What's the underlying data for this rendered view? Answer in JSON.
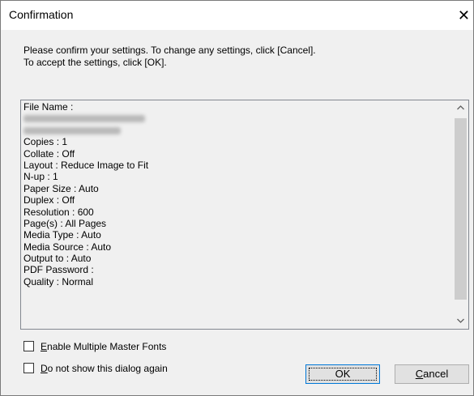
{
  "window": {
    "title": "Confirmation",
    "close_icon": "close-icon"
  },
  "message": {
    "line1": "Please confirm your settings. To change any settings, click [Cancel].",
    "line2": "To accept the settings, click [OK]."
  },
  "settings_list": {
    "file_name_label": "File Name :",
    "items": [
      "Copies : 1",
      "Collate : Off",
      "Layout : Reduce Image to Fit",
      "N-up : 1",
      "Paper Size : Auto",
      "Duplex : Off",
      "Resolution : 600",
      "Page(s) : All Pages",
      "Media Type : Auto",
      "Media Source : Auto",
      "Output to : Auto",
      "PDF Password :",
      "Quality : Normal"
    ],
    "scroll_up_icon": "chevron-up-icon",
    "scroll_down_icon": "chevron-down-icon"
  },
  "options": {
    "enable_master_fonts": {
      "accel": "E",
      "rest": "nable Multiple Master Fonts",
      "checked": false
    },
    "do_not_show": {
      "accel": "D",
      "rest": "o not show this dialog again",
      "checked": false
    }
  },
  "buttons": {
    "ok": "OK",
    "cancel_accel": "C",
    "cancel_rest": "ancel"
  }
}
